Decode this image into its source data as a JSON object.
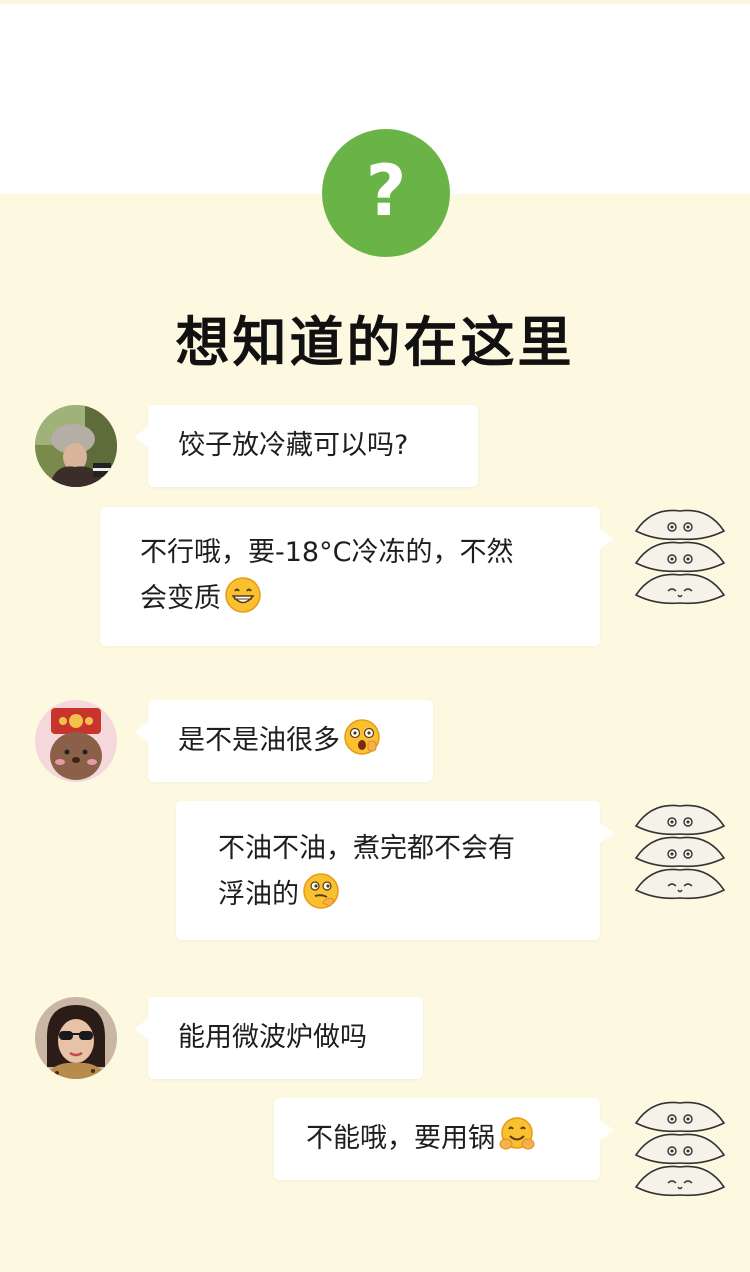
{
  "header": {
    "question_symbol": "?",
    "title": "想知道的在这里"
  },
  "colors": {
    "background": "#fdf8e0",
    "accent_green": "#6ab447",
    "bubble": "#ffffff",
    "text": "#1e1e1e"
  },
  "chat": [
    {
      "question": "饺子放冷藏可以吗?",
      "question_avatar": "avatar-woman-beret",
      "answer_lines": [
        "不行哦，要-18°C冷冻的，不然",
        "会变质"
      ],
      "answer_emoji": "grinning-face-icon",
      "answer_avatar": "dumpling-stack-icon"
    },
    {
      "question": "是不是油很多",
      "question_emoji": "surprised-face-icon",
      "question_avatar": "avatar-cartoon-bear",
      "answer_lines": [
        "不油不油，煮完都不会有",
        "浮油的"
      ],
      "answer_emoji": "thinking-face-icon",
      "answer_avatar": "dumpling-stack-icon"
    },
    {
      "question": "能用微波炉做吗",
      "question_avatar": "avatar-woman-sunglasses",
      "answer_lines": [
        "不能哦，要用锅"
      ],
      "answer_emoji": "hugging-face-icon",
      "answer_avatar": "dumpling-stack-icon"
    }
  ]
}
